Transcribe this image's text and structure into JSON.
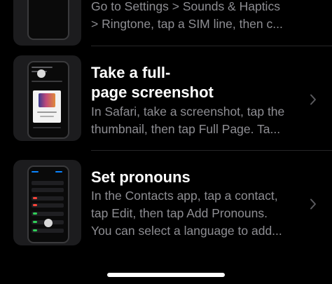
{
  "tips": [
    {
      "title": "",
      "description_lines": [
        "Go to Settings > Sounds & Haptics",
        "> Ringtone,  tap a SIM line, then c..."
      ]
    },
    {
      "title_lines": [
        "Take a full-",
        "page screenshot"
      ],
      "description_lines": [
        "In Safari, take a screenshot, tap the",
        "thumbnail, then tap Full Page. Ta..."
      ]
    },
    {
      "title_lines": [
        "Set pronouns"
      ],
      "description_lines": [
        "In the Contacts app, tap a contact,",
        "tap Edit, then tap Add Pronouns.",
        "You can select a language to add..."
      ]
    }
  ],
  "colors": {
    "background": "#000000",
    "title": "#ffffff",
    "description": "#8e8e93",
    "separator": "#262628",
    "thumbnail_bg": "#1c1c1e",
    "chevron": "#5a5a5e"
  },
  "icons": {
    "chevron": "chevron-right-icon"
  }
}
